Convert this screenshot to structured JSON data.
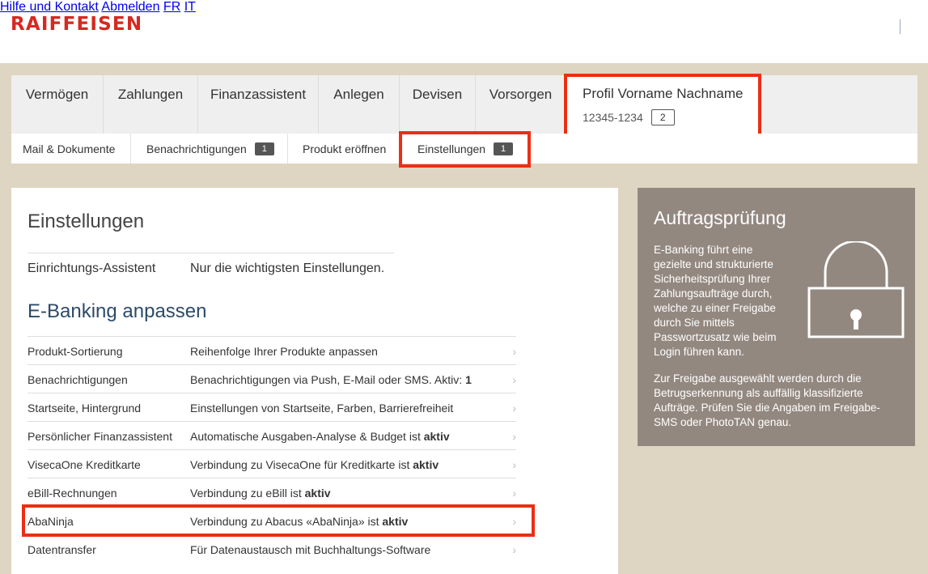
{
  "brand": {
    "logo_text": "RAIFFEISEN",
    "logo_color": "#d42a21",
    "link_color": "#2b63a5",
    "highlight_color": "#ea2f14"
  },
  "header": {
    "help": "Hilfe und Kontakt",
    "logout": "Abmelden",
    "lang_fr": "FR",
    "lang_it": "IT"
  },
  "main_nav": {
    "tabs": [
      "Vermögen",
      "Zahlungen",
      "Finanzassistent",
      "Anlegen",
      "Devisen",
      "Vorsorgen"
    ],
    "profile": {
      "name": "Profil Vorname Nachname",
      "number": "12345-1234",
      "count": "2"
    }
  },
  "sub_nav": {
    "mail": "Mail & Dokumente",
    "notifications": {
      "label": "Benachrichtigungen",
      "badge": "1"
    },
    "open_product": "Produkt eröffnen",
    "settings": {
      "label": "Einstellungen",
      "badge": "1"
    }
  },
  "content": {
    "title": "Einstellungen",
    "setup": {
      "key": "Einrichtungs-Assistent",
      "value": "Nur die wichtigsten Einstellungen."
    },
    "section_title": "E-Banking anpassen",
    "rows": [
      {
        "key": "Produkt-Sortierung",
        "value": "Reihenfolge Ihrer Produkte anpassen",
        "bold": ""
      },
      {
        "key": "Benachrichtigungen",
        "value": "Benachrichtigungen via Push, E-Mail oder SMS. Aktiv: ",
        "bold": "1"
      },
      {
        "key": "Startseite, Hintergrund",
        "value": "Einstellungen von Startseite, Farben, Barrierefreiheit",
        "bold": ""
      },
      {
        "key": "Persönlicher Finanzassistent",
        "value": "Automatische Ausgaben-Analyse & Budget ist ",
        "bold": "aktiv"
      },
      {
        "key": "VisecaOne Kreditkarte",
        "value": "Verbindung zu VisecaOne für Kreditkarte ist ",
        "bold": "aktiv"
      },
      {
        "key": "eBill-Rechnungen",
        "value": "Verbindung zu eBill ist ",
        "bold": "aktiv"
      },
      {
        "key": "AbaNinja",
        "value": "Verbindung zu Abacus «AbaNinja» ist ",
        "bold": "aktiv"
      },
      {
        "key": "Datentransfer",
        "value": "Für Datenaustausch mit Buchhaltungs-Software",
        "bold": ""
      }
    ]
  },
  "aside": {
    "title": "Auftragsprüfung",
    "p1": "E-Banking führt eine gezielte und strukturierte Sicherheitsprüfung Ihrer Zahlungsaufträge durch, welche zu einer Freigabe durch Sie mittels Passwortzusatz wie beim Login führen kann.",
    "p2": "Zur Freigabe ausgewählt werden durch die Betrugserkennung als auffällig klassifizierte Aufträge. Prüfen Sie die Angaben im Freigabe-SMS oder PhotoTAN genau.",
    "icon": "lock-icon"
  }
}
